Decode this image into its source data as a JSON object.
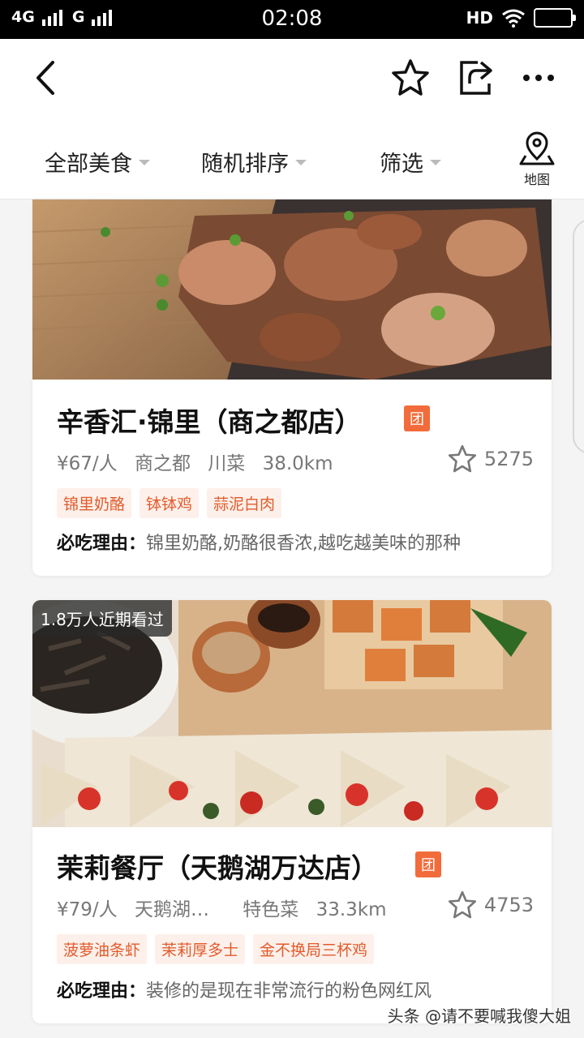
{
  "status_bar": {
    "signal1": "4G",
    "signal2": "G",
    "time": "02:08",
    "hd": "HD"
  },
  "filters": {
    "category": "全部美食",
    "sort": "随机排序",
    "filter": "筛选",
    "map": "地图"
  },
  "listings": [
    {
      "title": "辛香汇·锦里（商之都店）",
      "badge": "团",
      "price": "¥67/人",
      "area": "商之都",
      "cuisine": "川菜",
      "distance": "38.0km",
      "favorites": "5275",
      "tags": [
        "锦里奶酪",
        "钵钵鸡",
        "蒜泥白肉"
      ],
      "reason_label": "必吃理由：",
      "reason": "锦里奶酪,奶酪很香浓,越吃越美味的那种"
    },
    {
      "views": "1.8万人近期看过",
      "title": "茉莉餐厅（天鹅湖万达店）",
      "badge": "团",
      "price": "¥79/人",
      "area": "天鹅湖…",
      "cuisine": "特色菜",
      "distance": "33.3km",
      "favorites": "4753",
      "tags": [
        "菠萝油条虾",
        "茉莉厚多士",
        "金不换局三杯鸡"
      ],
      "reason_label": "必吃理由：",
      "reason": "装修的是现在非常流行的粉色网红风"
    }
  ],
  "watermark": "头条 @请不要喊我傻大姐",
  "colors": {
    "accent": "#f26b3a",
    "tag_bg": "#fdf0ea",
    "tag_text": "#e25b2c"
  }
}
